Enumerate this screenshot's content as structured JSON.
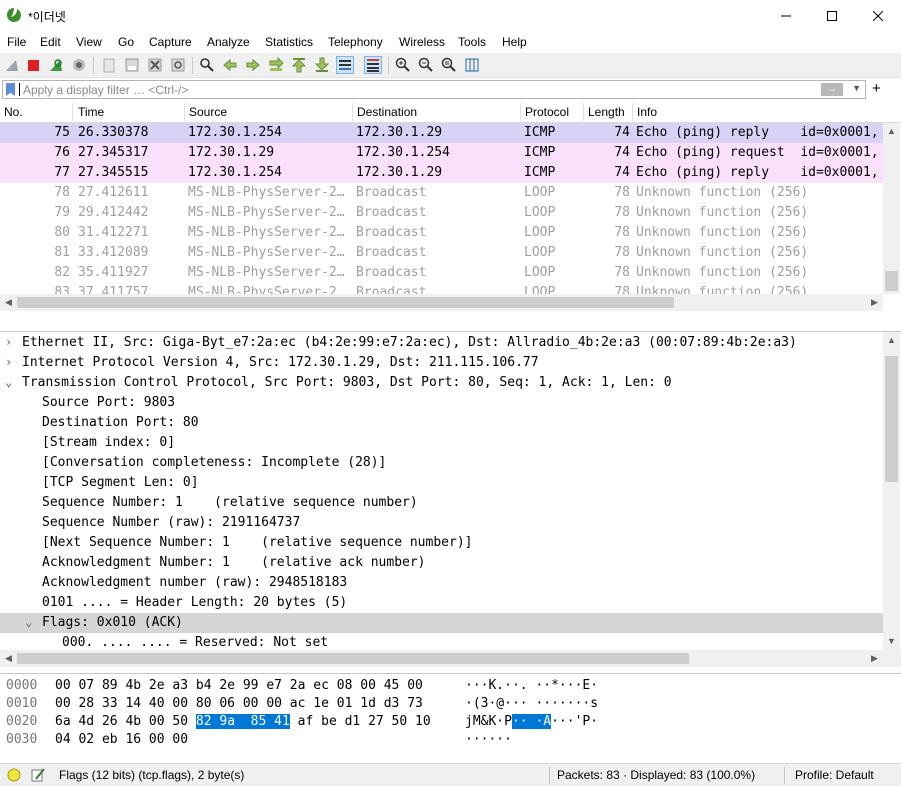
{
  "window": {
    "title": "*이더넷",
    "minimize": "—",
    "maximize": "☐",
    "close": "✕"
  },
  "menu": [
    "File",
    "Edit",
    "View",
    "Go",
    "Capture",
    "Analyze",
    "Statistics",
    "Telephony",
    "Wireless",
    "Tools",
    "Help"
  ],
  "toolbar": {
    "icons": [
      "shark-fin-start-icon",
      "stop-capture-icon",
      "restart-capture-icon",
      "capture-options-icon",
      "open-file-icon",
      "save-file-icon",
      "close-file-icon",
      "reload-file-icon",
      "find-packet-icon",
      "go-back-icon",
      "go-forward-icon",
      "go-to-packet-icon",
      "first-packet-icon",
      "last-packet-icon",
      "autoscroll-icon",
      "colorize-icon",
      "zoom-in-icon",
      "zoom-out-icon",
      "zoom-normal-icon",
      "resize-columns-icon"
    ]
  },
  "filter": {
    "placeholder": "Apply a display filter … <Ctrl-/>",
    "apply": "→",
    "plus": "+"
  },
  "packet_list": {
    "columns": [
      "No.",
      "Time",
      "Source",
      "Destination",
      "Protocol",
      "Length",
      "Info"
    ],
    "rows": [
      {
        "no": "75",
        "time": "26.330378",
        "src": "172.30.1.254",
        "dst": "172.30.1.29",
        "proto": "ICMP",
        "len": "74",
        "info": "Echo (ping) reply    id=0x0001,",
        "style": "sel"
      },
      {
        "no": "76",
        "time": "27.345317",
        "src": "172.30.1.29",
        "dst": "172.30.1.254",
        "proto": "ICMP",
        "len": "74",
        "info": "Echo (ping) request  id=0x0001,",
        "style": "icmp"
      },
      {
        "no": "77",
        "time": "27.345515",
        "src": "172.30.1.254",
        "dst": "172.30.1.29",
        "proto": "ICMP",
        "len": "74",
        "info": "Echo (ping) reply    id=0x0001,",
        "style": "icmp"
      },
      {
        "no": "78",
        "time": "27.412611",
        "src": "MS-NLB-PhysServer-2…",
        "dst": "Broadcast",
        "proto": "LOOP",
        "len": "78",
        "info": "Unknown function (256)",
        "style": "dim"
      },
      {
        "no": "79",
        "time": "29.412442",
        "src": "MS-NLB-PhysServer-2…",
        "dst": "Broadcast",
        "proto": "LOOP",
        "len": "78",
        "info": "Unknown function (256)",
        "style": "dim"
      },
      {
        "no": "80",
        "time": "31.412271",
        "src": "MS-NLB-PhysServer-2…",
        "dst": "Broadcast",
        "proto": "LOOP",
        "len": "78",
        "info": "Unknown function (256)",
        "style": "dim"
      },
      {
        "no": "81",
        "time": "33.412089",
        "src": "MS-NLB-PhysServer-2…",
        "dst": "Broadcast",
        "proto": "LOOP",
        "len": "78",
        "info": "Unknown function (256)",
        "style": "dim"
      },
      {
        "no": "82",
        "time": "35.411927",
        "src": "MS-NLB-PhysServer-2…",
        "dst": "Broadcast",
        "proto": "LOOP",
        "len": "78",
        "info": "Unknown function (256)",
        "style": "dim"
      },
      {
        "no": "83",
        "time": "37.411757",
        "src": "MS-NLB-PhysServer-2…",
        "dst": "Broadcast",
        "proto": "LOOP",
        "len": "78",
        "info": "Unknown function (256)",
        "style": "dim"
      }
    ]
  },
  "details": {
    "rows": [
      {
        "t": "›",
        "text": "Ethernet II, Src: Giga-Byt_e7:2a:ec (b4:2e:99:e7:2a:ec), Dst: Allradio_4b:2e:a3 (00:07:89:4b:2e:a3)",
        "lvl": 0
      },
      {
        "t": "›",
        "text": "Internet Protocol Version 4, Src: 172.30.1.29, Dst: 211.115.106.77",
        "lvl": 0
      },
      {
        "t": "⌄",
        "text": "Transmission Control Protocol, Src Port: 9803, Dst Port: 80, Seq: 1, Ack: 1, Len: 0",
        "lvl": 0
      },
      {
        "t": "",
        "text": "Source Port: 9803",
        "lvl": 1
      },
      {
        "t": "",
        "text": "Destination Port: 80",
        "lvl": 1
      },
      {
        "t": "",
        "text": "[Stream index: 0]",
        "lvl": 1
      },
      {
        "t": "",
        "text": "[Conversation completeness: Incomplete (28)]",
        "lvl": 1
      },
      {
        "t": "",
        "text": "[TCP Segment Len: 0]",
        "lvl": 1
      },
      {
        "t": "",
        "text": "Sequence Number: 1    (relative sequence number)",
        "lvl": 1
      },
      {
        "t": "",
        "text": "Sequence Number (raw): 2191164737",
        "lvl": 1
      },
      {
        "t": "",
        "text": "[Next Sequence Number: 1    (relative sequence number)]",
        "lvl": 1
      },
      {
        "t": "",
        "text": "Acknowledgment Number: 1    (relative ack number)",
        "lvl": 1
      },
      {
        "t": "",
        "text": "Acknowledgment number (raw): 2948518183",
        "lvl": 1
      },
      {
        "t": "",
        "text": "0101 .... = Header Length: 20 bytes (5)",
        "lvl": 1
      },
      {
        "t": "⌄",
        "text": "Flags: 0x010 (ACK)",
        "lvl": 1,
        "hl": true
      },
      {
        "t": "",
        "text": "000. .... .... = Reserved: Not set",
        "lvl": 2
      }
    ]
  },
  "bytes": {
    "rows": [
      {
        "off": "0000",
        "hex": "00 07 89 4b 2e a3 b4 2e  99 e7 2a ec 08 00 45 00",
        "ascii": "···K.··. ··*···E·"
      },
      {
        "off": "0010",
        "hex": "00 28 33 14 40 00 80 06  00 00 ac 1e 01 1d d3 73",
        "ascii": "·(3·@··· ·······s"
      },
      {
        "off": "0020",
        "hex_pre": "6a 4d 26 4b 00 50 ",
        "hex_hl": "82 9a  85 41",
        "hex_post": " af be d1 27 50 10",
        "ascii_pre": "jM&K·P",
        "ascii_hl": "·· ·A",
        "ascii_post": "···'P·"
      },
      {
        "off": "0030",
        "hex": "04 02 eb 16 00 00",
        "ascii": "······"
      }
    ]
  },
  "status": {
    "field": "Flags (12 bits) (tcp.flags), 2 byte(s)",
    "packets": "Packets: 83 · Displayed: 83 (100.0%)",
    "profile": "Profile: Default"
  }
}
